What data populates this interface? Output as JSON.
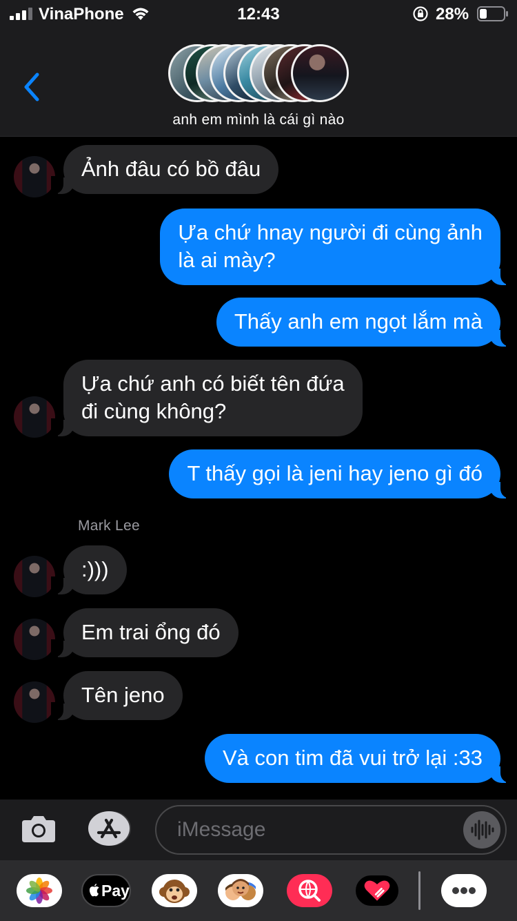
{
  "status_bar": {
    "carrier": "VinaPhone",
    "time": "12:43",
    "battery": "28%"
  },
  "header": {
    "title": "anh em mình là cái gì nào"
  },
  "thread": {
    "messages": [
      {
        "direction": "incoming",
        "text": "Ảnh đâu có bồ đâu"
      },
      {
        "direction": "outgoing",
        "text": [
          "Ựa chứ hnay người đi cùng ảnh",
          "là ai mày?"
        ]
      },
      {
        "direction": "outgoing",
        "text": "Thấy anh em ngọt lắm mà"
      },
      {
        "direction": "incoming",
        "text": [
          "Ựa chứ anh có biết tên đứa",
          "đi cùng không?"
        ]
      },
      {
        "direction": "outgoing",
        "text": "T thấy gọi là jeni hay jeno gì đó"
      },
      {
        "direction": "incoming",
        "sender": "Mark Lee",
        "text": ":)))"
      },
      {
        "direction": "incoming",
        "text": "Em trai ổng đó"
      },
      {
        "direction": "incoming",
        "text": "Tên jeno"
      },
      {
        "direction": "outgoing",
        "text": "Và con tim đã vui trở lại :33"
      }
    ]
  },
  "compose": {
    "placeholder": "iMessage"
  },
  "app_drawer": {
    "apple_pay_label": "Pay"
  },
  "icons": {
    "back": "chevron-left-icon",
    "camera": "camera-icon",
    "app_store": "app-store-icon",
    "audio": "waveform-icon",
    "photos": "photos-icon",
    "memoji": "memoji-icon",
    "search": "web-search-icon",
    "digital_touch": "heart-icon",
    "more": "ellipsis-icon"
  },
  "colors": {
    "outgoing_bubble": "#0a84ff",
    "incoming_bubble": "#262628",
    "background": "#000000",
    "bar": "#1c1c1e",
    "accent": "#0a84ff"
  }
}
